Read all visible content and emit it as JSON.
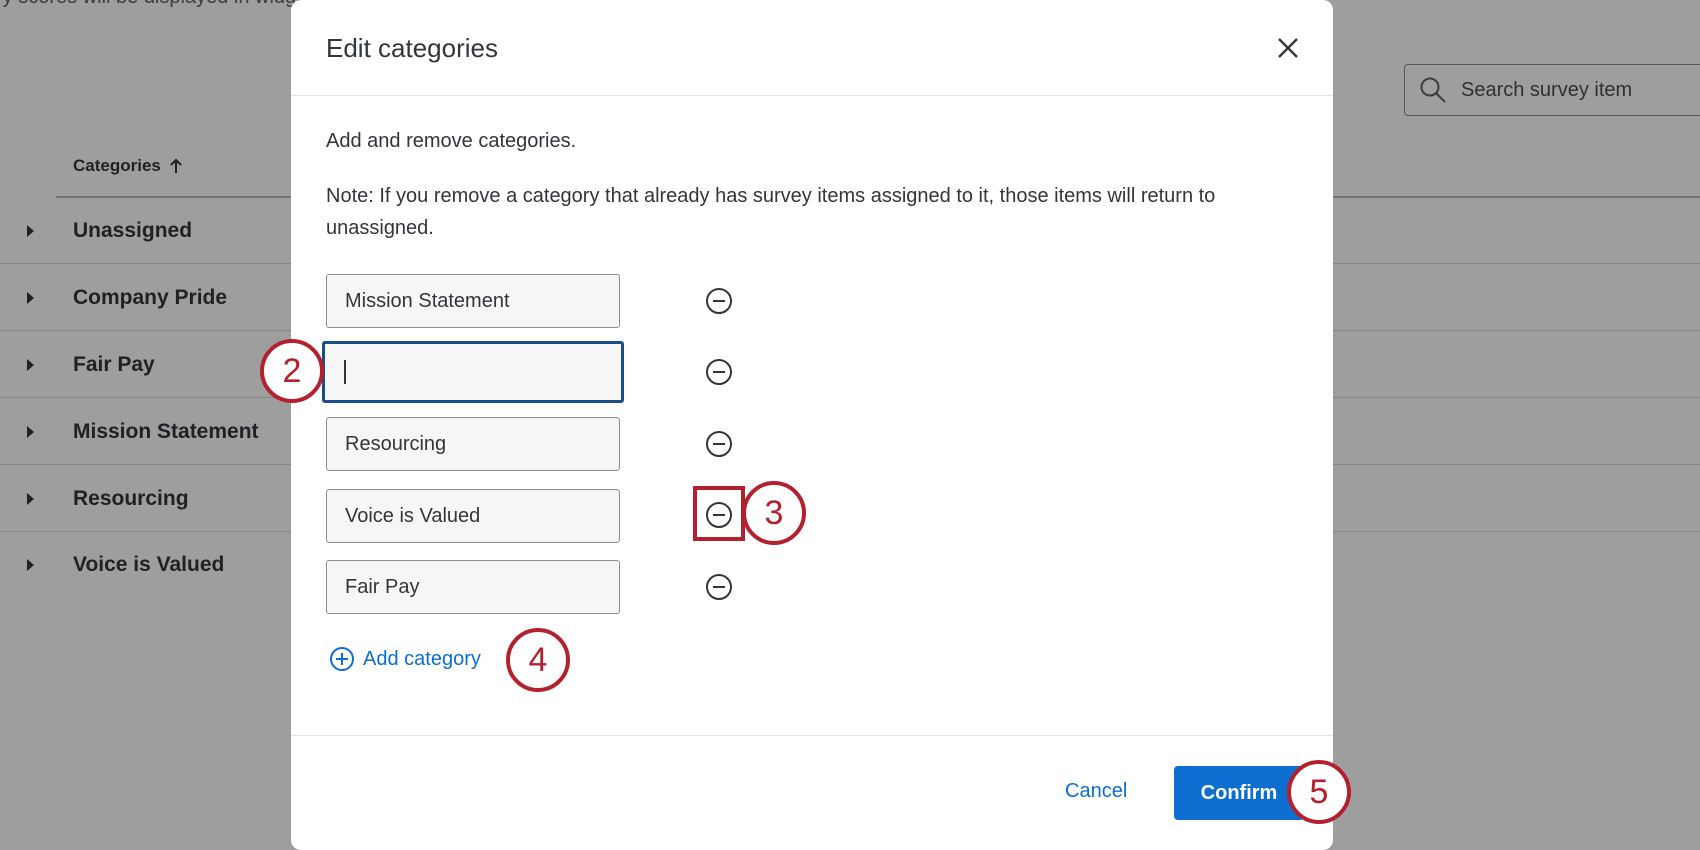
{
  "background": {
    "top_text": "ry scores will be displayed in widgets for this dashboard.",
    "search_placeholder": "Search survey item",
    "column_header": "Categories",
    "rows": [
      "Unassigned",
      "Company Pride",
      "Fair Pay",
      "Mission Statement",
      "Resourcing",
      "Voice is Valued"
    ]
  },
  "modal": {
    "title": "Edit categories",
    "intro": "Add and remove categories.",
    "note": "Note: If you remove a category that already has survey items assigned to it, those items will return to unassigned.",
    "categories": [
      {
        "value": "Mission Statement"
      },
      {
        "value": ""
      },
      {
        "value": "Resourcing"
      },
      {
        "value": "Voice is Valued"
      },
      {
        "value": "Fair Pay"
      }
    ],
    "add_category_label": "Add category",
    "cancel_label": "Cancel",
    "confirm_label": "Confirm"
  },
  "callouts": [
    "2",
    "3",
    "4",
    "5"
  ],
  "colors": {
    "accent": "#0b6ed0",
    "callout": "#b5202e",
    "focus": "#1a4e8a"
  }
}
